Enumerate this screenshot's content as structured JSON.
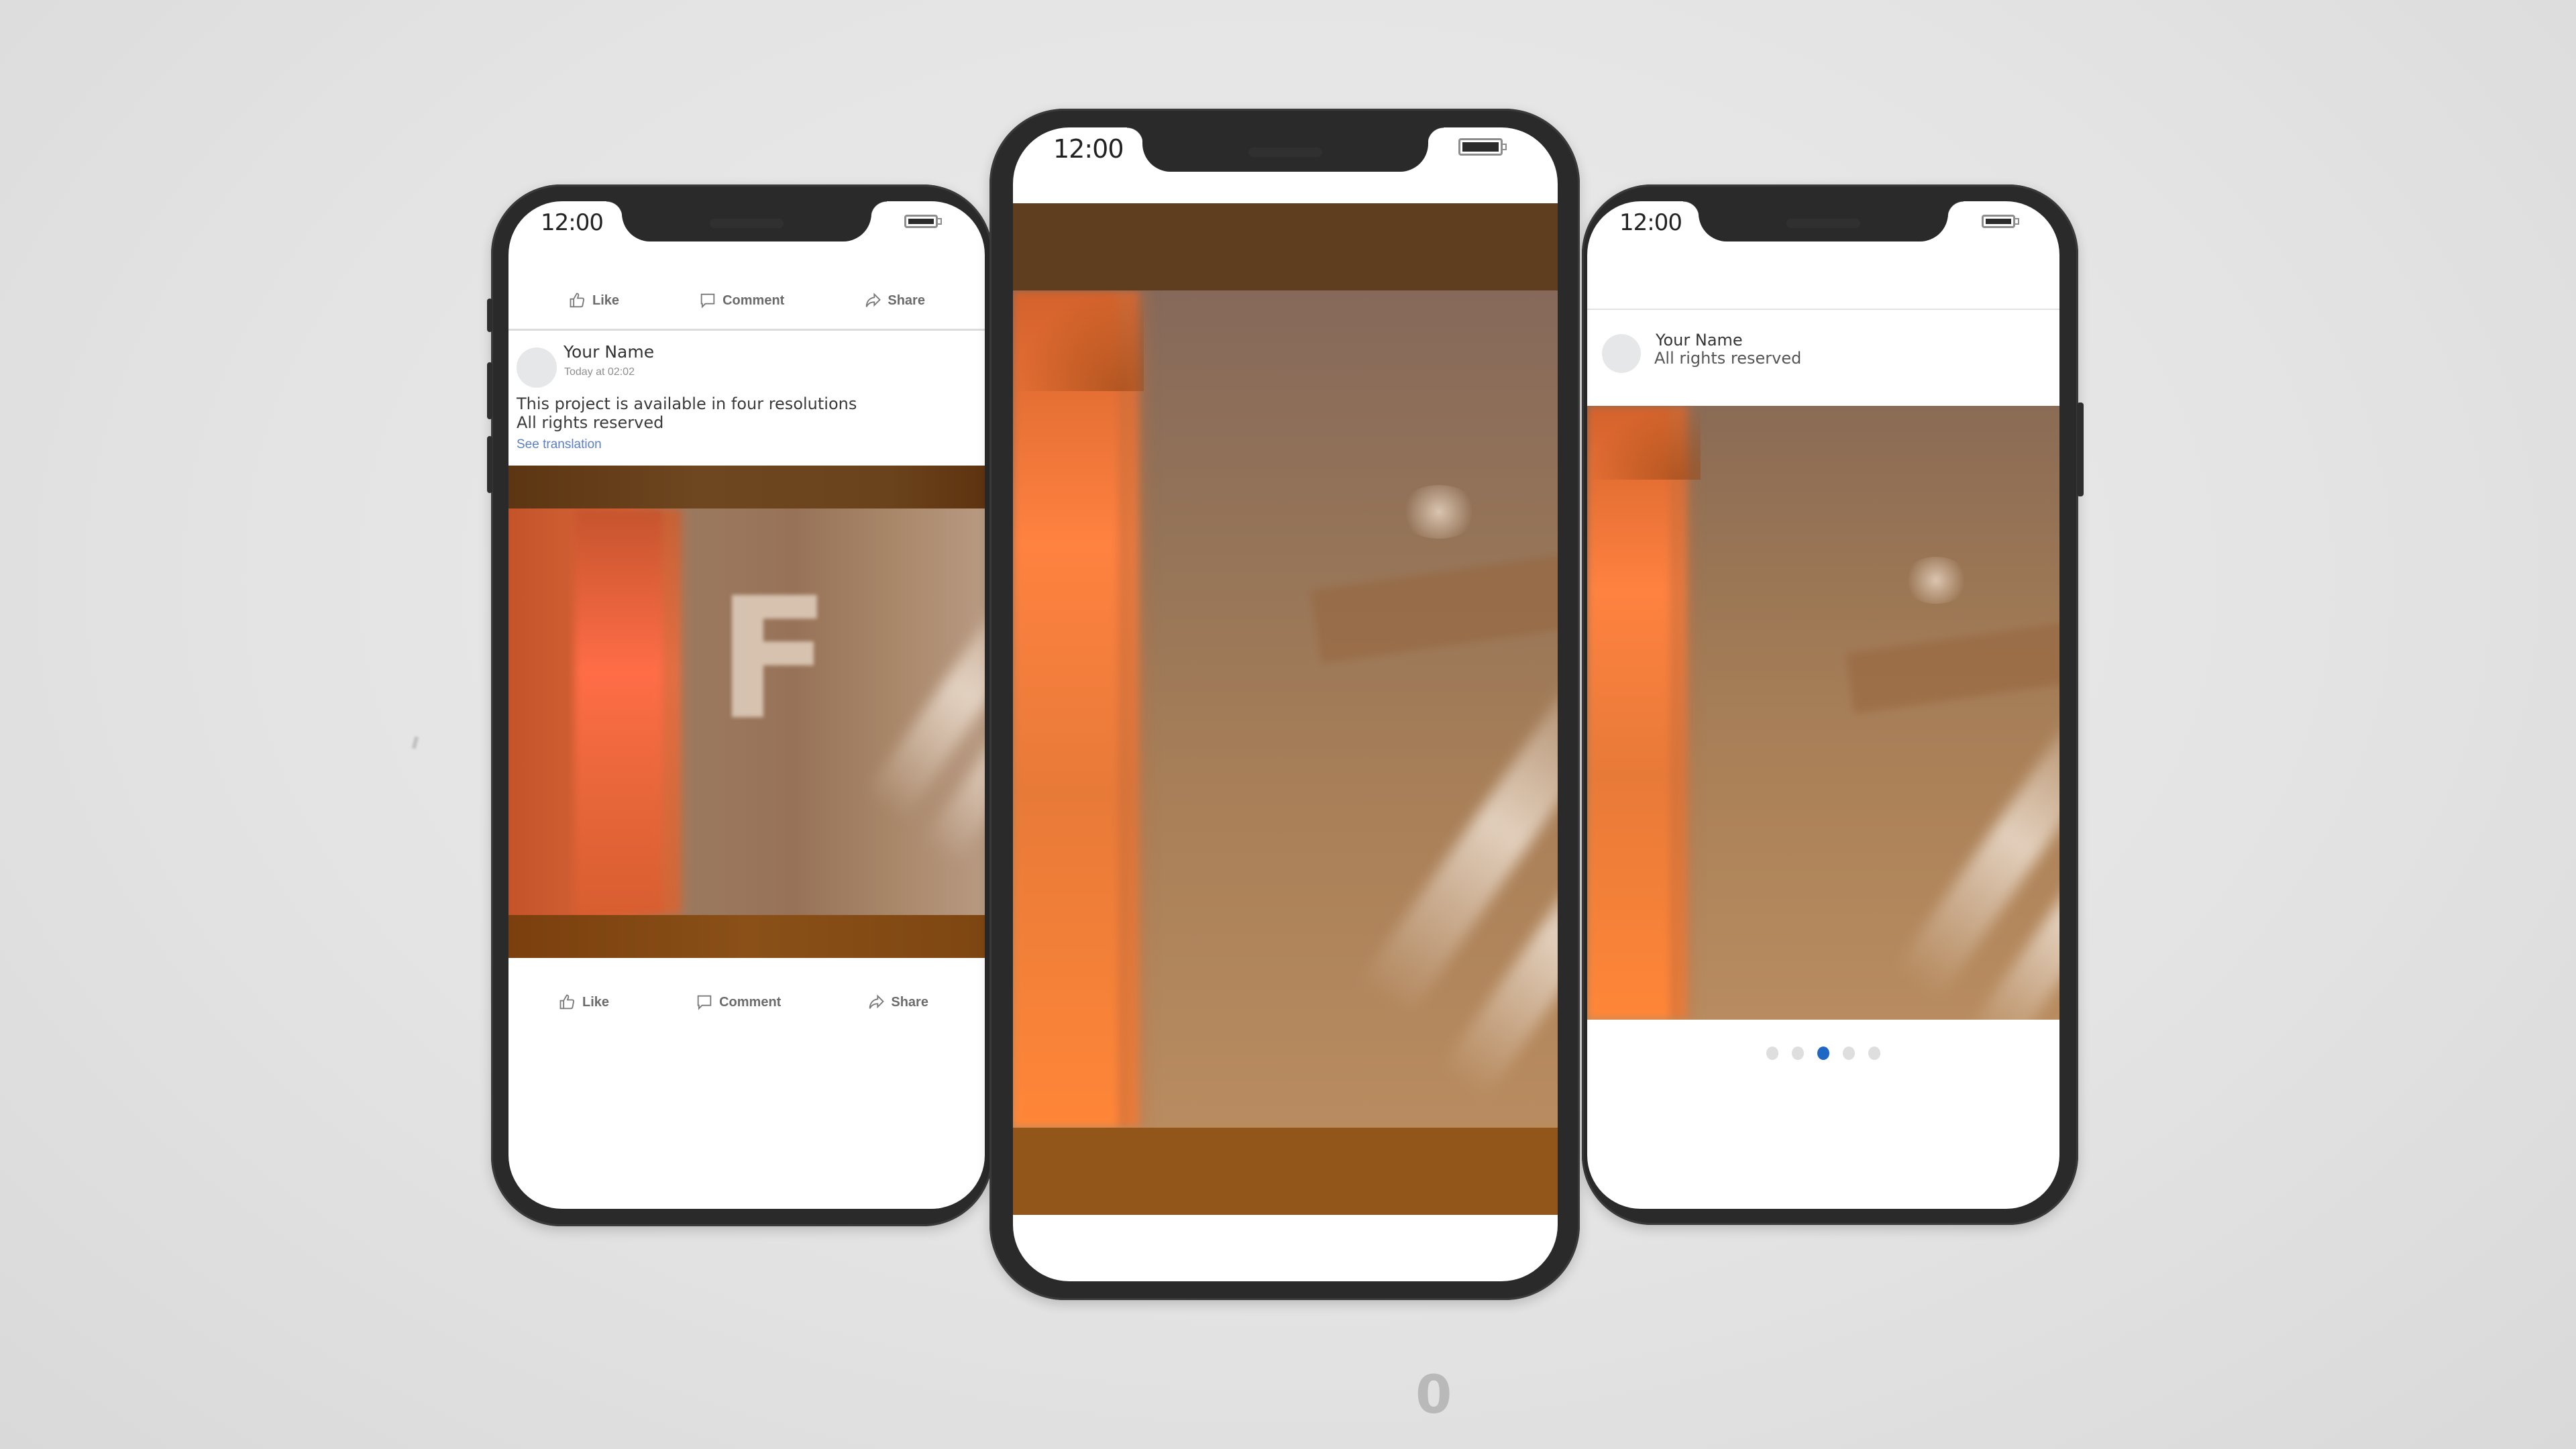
{
  "colors": {
    "background": "#e4e4e4",
    "phone_frame": "#2a2a2a",
    "screen": "#ffffff",
    "link": "#5b7fc4",
    "active_dot": "#1f67c4",
    "inactive_dot": "#dedede",
    "band_dark": "#5f3e1f",
    "band_warm": "#93561a"
  },
  "left_phone": {
    "status": {
      "time": "12:00",
      "battery_icon": "battery-full-icon"
    },
    "top_actions": [
      {
        "icon": "thumbs-up-icon",
        "label": "Like"
      },
      {
        "icon": "comment-icon",
        "label": "Comment"
      },
      {
        "icon": "share-icon",
        "label": "Share"
      }
    ],
    "post": {
      "author": "Your Name",
      "timestamp": "Today at 02:02",
      "text_line1": "This project is available in four resolutions",
      "text_line2": "All rights reserved",
      "see_translation": "See translation"
    },
    "media_overlay_letter": "F",
    "bottom_actions": [
      {
        "icon": "thumbs-up-icon",
        "label": "Like"
      },
      {
        "icon": "comment-icon",
        "label": "Comment"
      },
      {
        "icon": "share-icon",
        "label": "Share"
      }
    ]
  },
  "center_phone": {
    "status": {
      "time": "12:00",
      "battery_icon": "battery-full-icon"
    }
  },
  "right_phone": {
    "status": {
      "time": "12:00",
      "battery_icon": "battery-full-icon"
    },
    "post": {
      "author": "Your Name",
      "subtitle": "All rights reserved"
    },
    "carousel": {
      "total": 5,
      "active_index": 2
    }
  },
  "footer": {
    "counter": "0"
  }
}
